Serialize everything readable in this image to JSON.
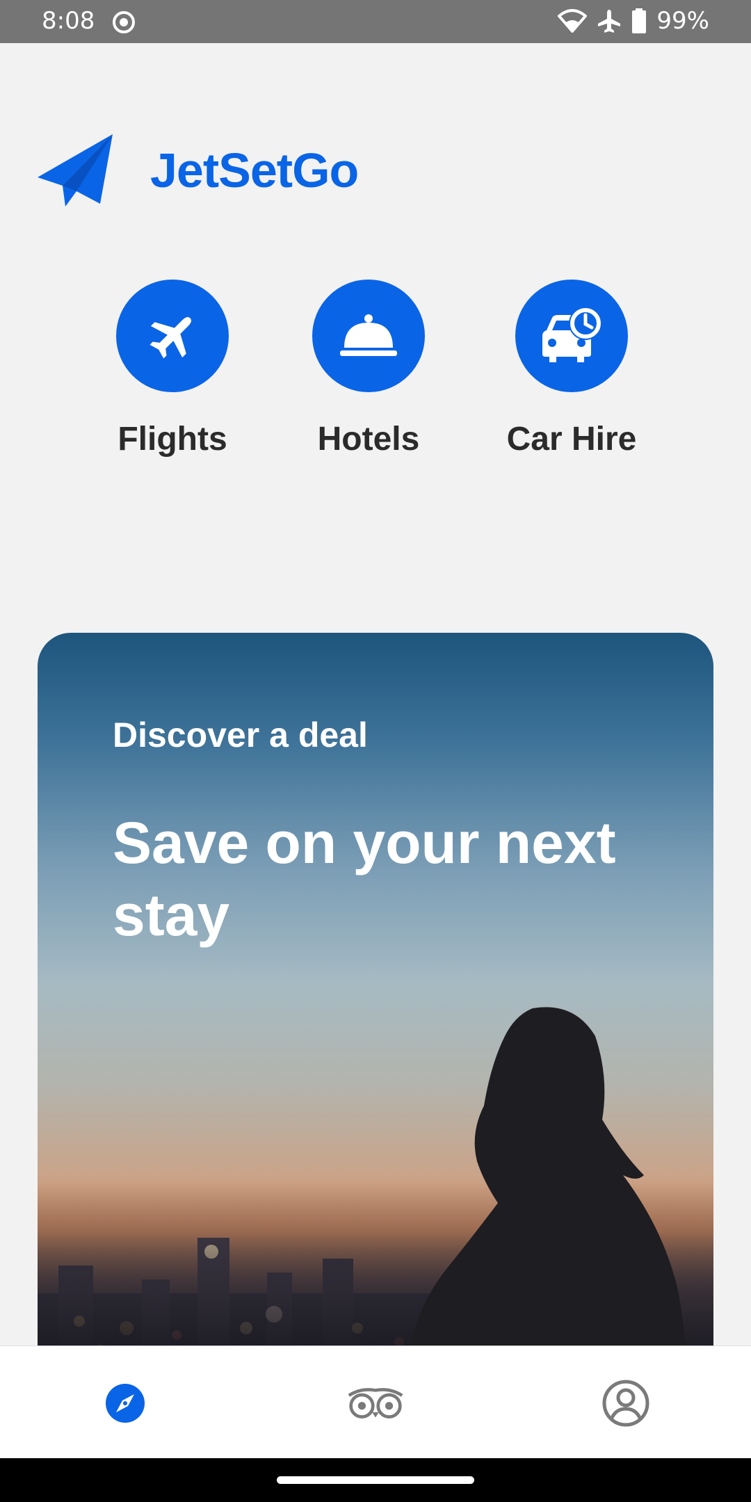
{
  "status_bar": {
    "time": "8:08",
    "battery": "99%",
    "icons": [
      "screen-record-icon",
      "wifi-icon",
      "airplane-mode-icon",
      "battery-icon"
    ]
  },
  "brand": {
    "name": "JetSetGo",
    "logo_icon": "paper-plane-icon",
    "color": "#0a64e6"
  },
  "categories": [
    {
      "label": "Flights",
      "icon": "airplane-icon"
    },
    {
      "label": "Hotels",
      "icon": "room-service-bell-icon"
    },
    {
      "label": "Car Hire",
      "icon": "car-clock-icon"
    }
  ],
  "deal": {
    "eyebrow": "Discover a deal",
    "headline": "Save on your next stay"
  },
  "bottom_nav": [
    {
      "icon": "compass-icon",
      "active": true
    },
    {
      "icon": "owl-icon",
      "active": false
    },
    {
      "icon": "profile-icon",
      "active": false
    }
  ]
}
